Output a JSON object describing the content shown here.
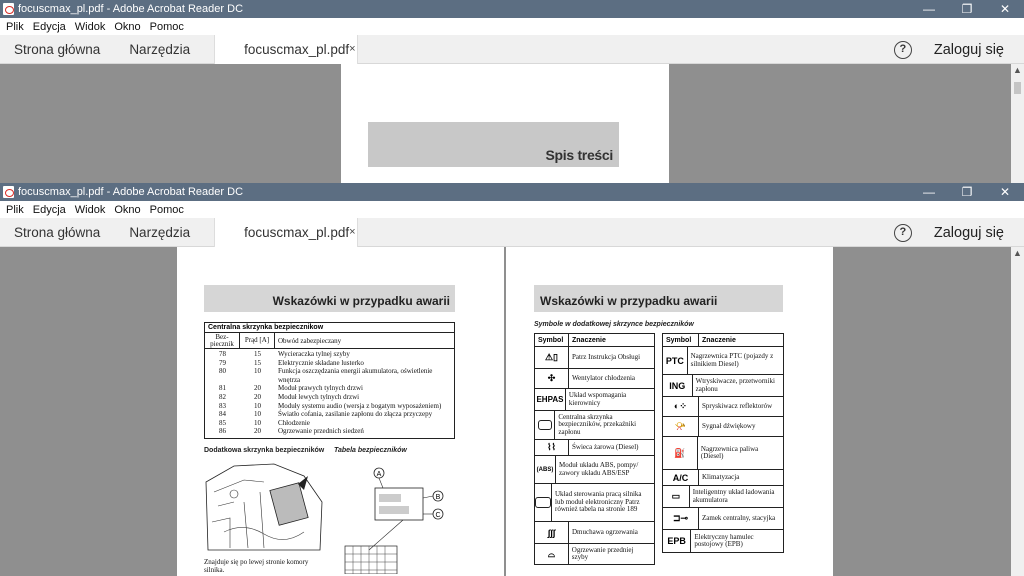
{
  "window": {
    "title": "focuscmax_pl.pdf - Adobe Acrobat Reader DC",
    "controls": {
      "minimize": "—",
      "restore": "❐",
      "close": "✕"
    }
  },
  "menu": [
    "Plik",
    "Edycja",
    "Widok",
    "Okno",
    "Pomoc"
  ],
  "tabs": {
    "home": "Strona główna",
    "tools": "Narzędzia",
    "document": "focuscmax_pl.pdf",
    "close": "×"
  },
  "toolbar": {
    "help": "?",
    "login": "Zaloguj się"
  },
  "cover": {
    "title": "Spis treści"
  },
  "left_page": {
    "heading": "Wskazówki w przypadku awarii",
    "table_caption": "Centralna skrzynka bezpiecznikow",
    "columns": [
      "Bez-piecznik",
      "Prąd [A]",
      "Obwód zabezpieczany"
    ],
    "rows": [
      [
        "78",
        "15",
        "Wycieraczka tylnej szyby"
      ],
      [
        "79",
        "15",
        "Elektrycznie składane lusterko"
      ],
      [
        "80",
        "10",
        "Funkcja oszczędzania energii akumulatora, oświetlenie wnętrza"
      ],
      [
        "81",
        "20",
        "Moduł prawych tylnych drzwi"
      ],
      [
        "82",
        "20",
        "Moduł lewych tylnych drzwi"
      ],
      [
        "83",
        "10",
        "Moduły systemu audio (wersja z bogatym wyposażeniem)"
      ],
      [
        "84",
        "10",
        "Światło cofania, zasilanie zapłonu do złącza przyczepy"
      ],
      [
        "85",
        "10",
        "Chłodzenie"
      ],
      [
        "86",
        "20",
        "Ogrzewanie przednich siedzeń"
      ]
    ],
    "subheading": "Dodatkowa skrzynka bezpieczników",
    "subheading2": "Tabela bezpieczników",
    "callouts": [
      "A",
      "B",
      "C"
    ],
    "note": "Znajduje się po lewej stronie komory silnika."
  },
  "right_page": {
    "heading": "Wskazówki w przypadku awarii",
    "subtitle": "Symbole w dodatkowej skrzynce bezpieczników",
    "col_symbol": "Symbol",
    "col_meaning": "Znaczenie",
    "left_table": [
      {
        "sym": "warning-manual-icon",
        "text": "Patrz Instrukcja Obsługi"
      },
      {
        "sym": "fan-icon",
        "text": "Wentylator chłodzenia"
      },
      {
        "sym": "EHPAS",
        "text": "Układ wspomagania kierownicy"
      },
      {
        "sym": "fusebox-icon",
        "text": "Centralna skrzynka bezpieczników, przekaźniki zapłonu"
      },
      {
        "sym": "glowplug-icon",
        "text": "Świeca żarowa (Diesel)"
      },
      {
        "sym": "abs-icon",
        "text": "Moduł układu ABS, pompy/ zawory układu ABS/ESP"
      },
      {
        "sym": "engine-icon",
        "text": "Układ sterowania pracą silnika lub moduł elektroniczny Patrz również tabela na stronie 189"
      },
      {
        "sym": "heater-icon",
        "text": "Dmuchawa ogrzewania"
      },
      {
        "sym": "windshield-heat-icon",
        "text": "Ogrzewanie przedniej szyby"
      }
    ],
    "right_table": [
      {
        "sym": "PTC",
        "text": "Nagrzewnica PTC (pojazdy z silnikiem Diesel)"
      },
      {
        "sym": "ING",
        "text": "Wtryskiwacze, przetworniki zapłonu"
      },
      {
        "sym": "headlamp-washer-icon",
        "text": "Spryskiwacz reflektorów"
      },
      {
        "sym": "horn-icon",
        "text": "Sygnał dźwiękowy"
      },
      {
        "sym": "fuel-heater-icon",
        "text": "Nagrzewnica paliwa (Diesel)"
      },
      {
        "sym": "A/C",
        "text": "Klimatyzacja"
      },
      {
        "sym": "battery-icon",
        "text": "Inteligentny układ ładowania akumulatora"
      },
      {
        "sym": "lock-icon",
        "text": "Zamek centralny, stacyjka"
      },
      {
        "sym": "EPB",
        "text": "Elektryczny hamulec postojowy (EPB)"
      }
    ]
  }
}
